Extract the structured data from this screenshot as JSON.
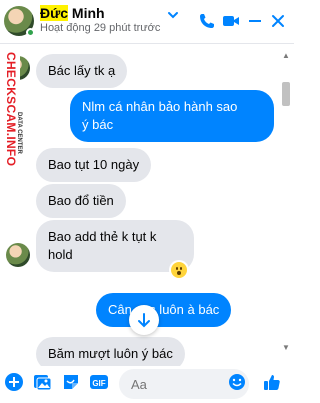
{
  "header": {
    "name_first": "Đức",
    "name_rest": " Minh",
    "status": "Hoạt động 29 phút trước",
    "icons": [
      "chevron-down-icon",
      "phone-icon",
      "video-icon",
      "minimize-icon",
      "close-icon"
    ]
  },
  "watermark": {
    "main": "CHECKSCAM.INFO",
    "sub": "DATA CENTER"
  },
  "messages": [
    {
      "side": "in",
      "text": "Bác lấy tk ạ"
    },
    {
      "side": "out",
      "line1": "Nlm cá nhân bảo hành sao",
      "line2": "ý bác"
    },
    {
      "side": "in",
      "text": "Bao tụt 10 ngày"
    },
    {
      "side": "in",
      "text": "Bao đổ tiền"
    },
    {
      "side": "in",
      "line1": "Bao add thẻ k tụt k",
      "line2": "hold",
      "reaction": "wow-reaction"
    },
    {
      "side": "out",
      "text": "Cân          pcs luôn à bác"
    },
    {
      "side": "in",
      "text": "Băm mượt luôn ý bác"
    }
  ],
  "composer": {
    "placeholder": "Aa",
    "icons": [
      "add-icon",
      "photo-icon",
      "sticker-icon",
      "gif-icon",
      "emoji-icon",
      "like-icon"
    ]
  },
  "colors": {
    "accent": "#0084ff",
    "incoming_bubble": "#e4e6eb",
    "online": "#31a24c",
    "watermark_red": "#e41e26"
  }
}
